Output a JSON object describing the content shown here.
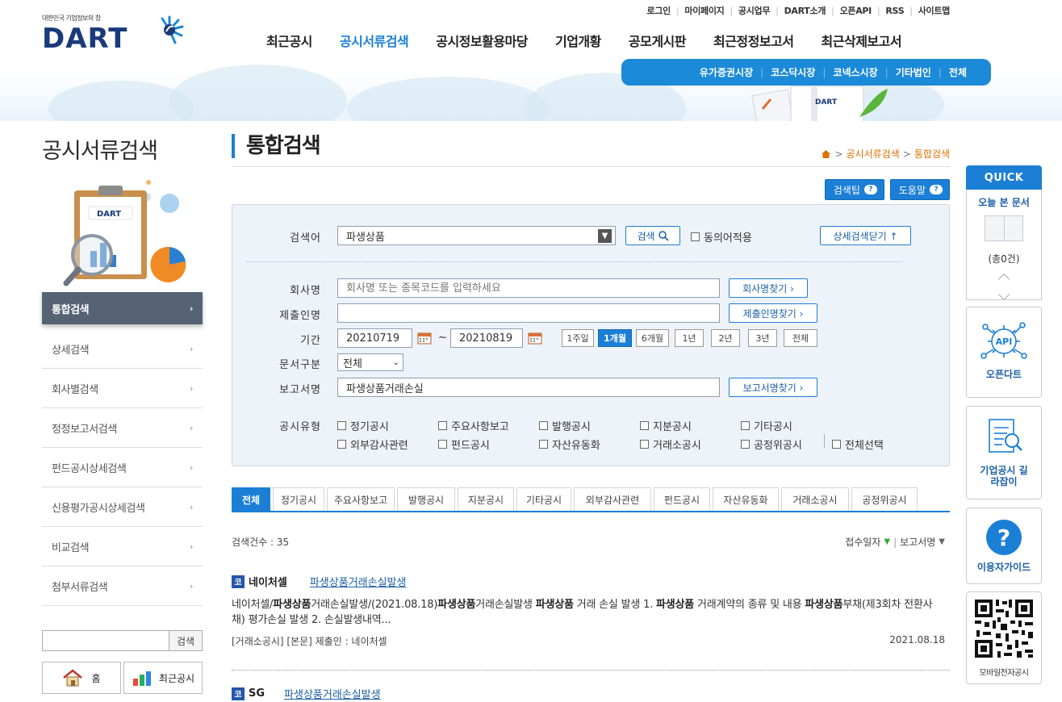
{
  "header": {
    "logo_tagline": "대한민국 기업정보의 창",
    "logo_text": "DART",
    "top_links": [
      "로그인",
      "마이페이지",
      "공시업무",
      "DART소개",
      "오픈API",
      "RSS",
      "사이트맵"
    ],
    "gnb": [
      "최근공시",
      "공시서류검색",
      "공시정보활용마당",
      "기업개황",
      "공모게시판",
      "최근정정보고서",
      "최근삭제보고서"
    ],
    "gnb_active_index": 1,
    "subnav": [
      "유가증권시장",
      "코스닥시장",
      "코넥스시장",
      "기타법인",
      "전체"
    ],
    "banner_book_text": "DART"
  },
  "lnb": {
    "title": "공시서류검색",
    "illust_text": "DART",
    "menu": [
      "통합검색",
      "상세검색",
      "회사별검색",
      "정정보고서검색",
      "펀드공시상세검색",
      "신용평가공시상세검색",
      "비교검색",
      "첨부서류검색"
    ],
    "active_index": 0,
    "arrow": "›",
    "search_button": "검색",
    "home_label": "홈",
    "recent_label": "최근공시"
  },
  "content": {
    "page_title": "통합검색",
    "breadcrumb": [
      "공시서류검색",
      "통합검색"
    ],
    "breadcrumb_sep": ">",
    "search_tip": "검색팁",
    "help": "도움말",
    "help_bubble": "?",
    "search": {
      "keyword_label": "검색어",
      "keyword_value": "파생상품",
      "search_btn": "검색",
      "synonym_label": "동의어적용",
      "detail_toggle": "상세검색닫기 ↑",
      "company_label": "회사명",
      "company_placeholder": "회사명 또는 종목코드를 입력하세요",
      "company_find": "회사명찾기 ›",
      "submitter_label": "제출인명",
      "submitter_value": "",
      "submitter_find": "제출인명찾기 ›",
      "period_label": "기간",
      "date_from": "20210719",
      "date_sep": "~",
      "date_to": "20210819",
      "period_buttons": [
        "1주일",
        "1개월",
        "6개월",
        "1년",
        "2년",
        "3년",
        "전체"
      ],
      "period_active_index": 1,
      "doctype_label": "문서구분",
      "doctype_value": "전체",
      "report_label": "보고서명",
      "report_value": "파생상품거래손실",
      "report_find": "보고서명찾기 ›",
      "disclosure_label": "공시유형",
      "disclosure_types": [
        "정기공시",
        "주요사항보고",
        "발행공시",
        "지분공시",
        "기타공시",
        "외부감사관련",
        "펀드공시",
        "자산유동화",
        "거래소공시",
        "공정위공시"
      ],
      "select_all": "전체선택"
    },
    "tabs": [
      "전체",
      "정기공시",
      "주요사항보고",
      "발행공시",
      "지분공시",
      "기타공시",
      "외부감사관련",
      "펀드공시",
      "자산유동화",
      "거래소공시",
      "공정위공시"
    ],
    "tab_active_index": 0,
    "result_count": "검색건수 : 35",
    "sort": {
      "date": "접수일자",
      "name": "보고서명",
      "sep": "|"
    },
    "results": [
      {
        "market_badge": "코",
        "company": "네이처셀",
        "title": "파생상품거래손실발생",
        "body_parts": [
          {
            "t": "네이처셀/",
            "b": false
          },
          {
            "t": "파생상품",
            "b": true
          },
          {
            "t": "거래손실발생/(2021.08.18)",
            "b": false
          },
          {
            "t": "파생상품",
            "b": true
          },
          {
            "t": "거래손실발생 ",
            "b": false
          },
          {
            "t": "파생상품",
            "b": true
          },
          {
            "t": " 거래 손실 발생 1. ",
            "b": false
          },
          {
            "t": "파생상품",
            "b": true
          },
          {
            "t": " 거래계약의 종류 및 내용 ",
            "b": false
          },
          {
            "t": "파생상품",
            "b": true
          },
          {
            "t": "부채(제3회차 전환사채) 평가손실 발생 2. 손실발생내역...",
            "b": false
          }
        ],
        "meta": "[거래소공시] [본문] 제출인 : 네이처셀",
        "date": "2021.08.18"
      },
      {
        "market_badge": "코",
        "company": "SG",
        "title": "파생상품거래손실발생"
      }
    ]
  },
  "quick": {
    "header": "QUICK",
    "recent_title": "오늘 본 문서",
    "recent_count": "(총0건)",
    "openapi_label": "오픈다트",
    "openapi_icon_text": "API",
    "guide_label": "기업공시 길라잡이",
    "user_guide_label": "이용자가이드",
    "user_guide_icon": "?",
    "mobile_label": "모바일전자공시"
  },
  "colors": {
    "primary": "#1b7fd6",
    "navy": "#1a3a7a",
    "sidebar_active": "#556374",
    "breadcrumb": "#e06d00"
  }
}
